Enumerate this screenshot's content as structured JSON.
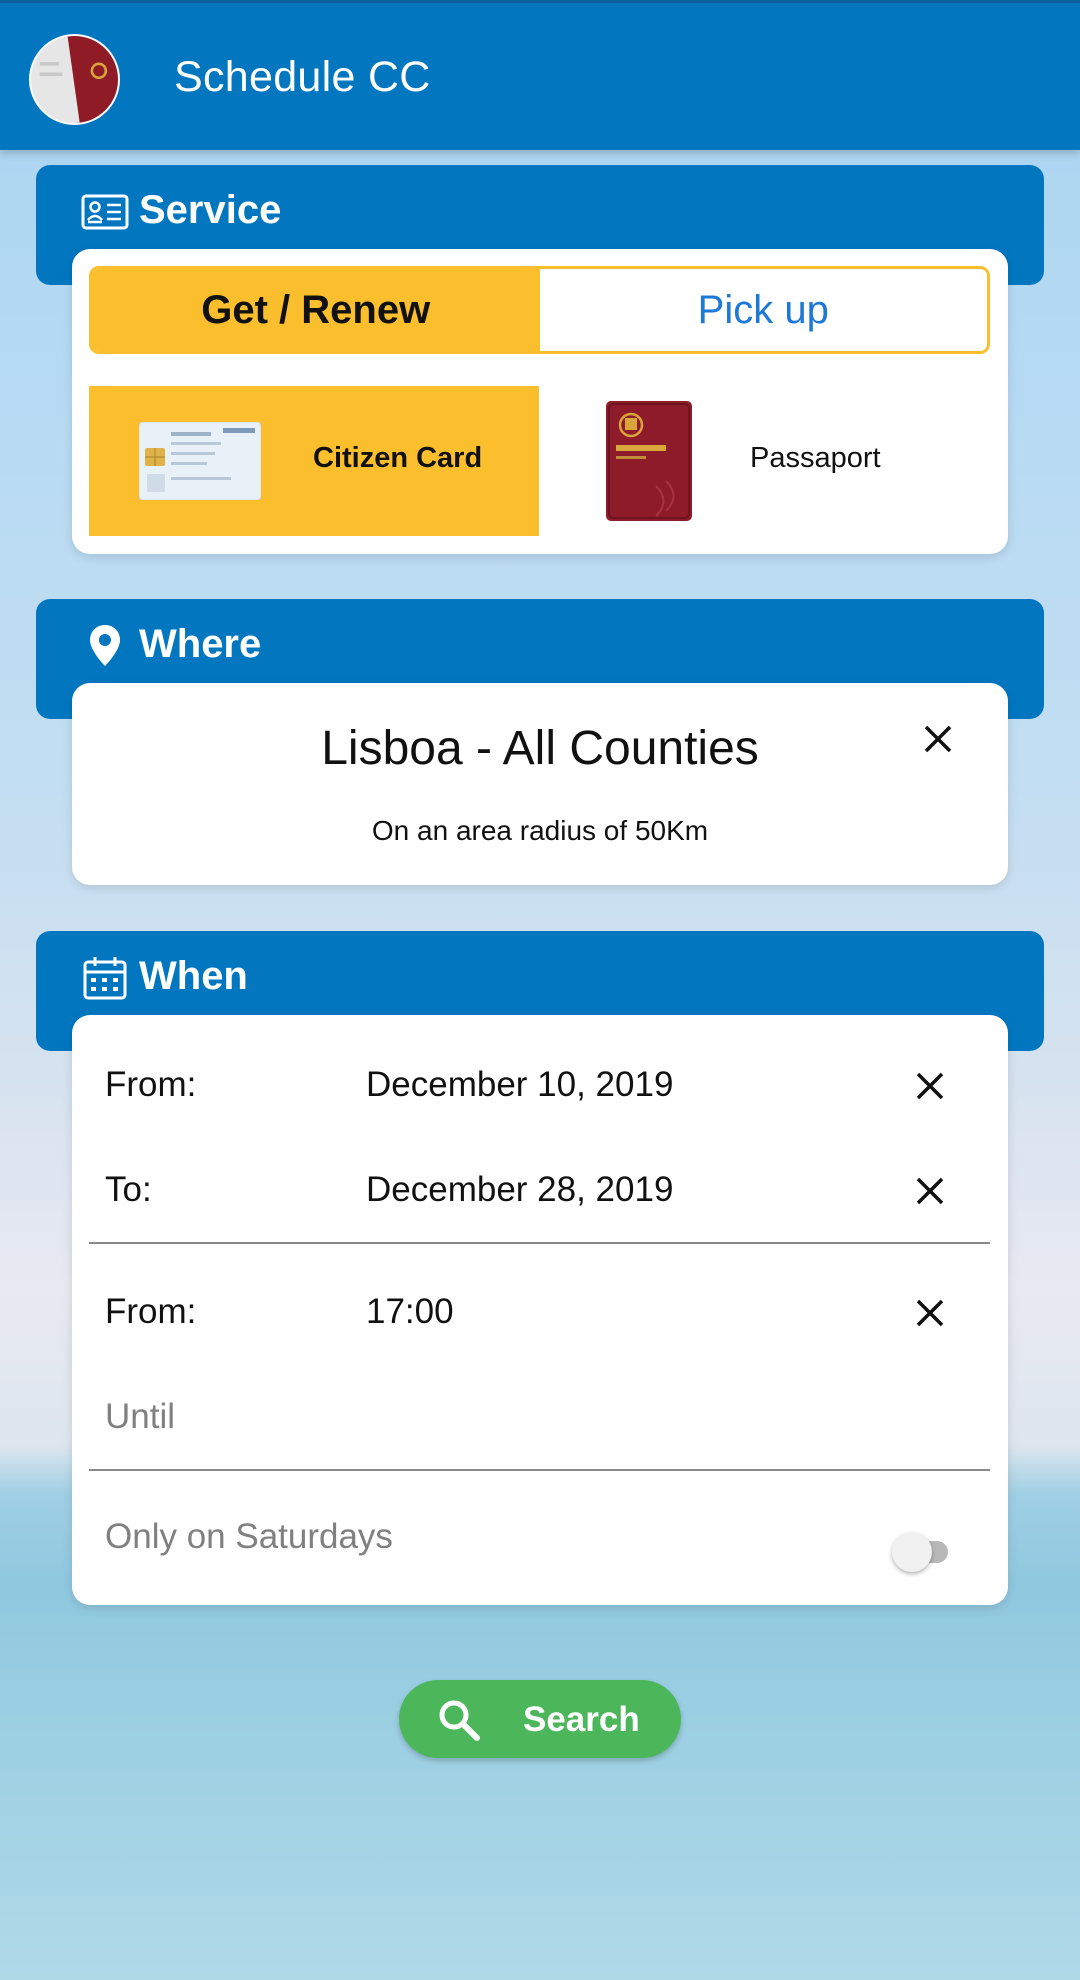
{
  "app": {
    "title": "Schedule CC"
  },
  "service": {
    "title": "Service",
    "tabs": [
      {
        "label": "Get / Renew",
        "selected": true
      },
      {
        "label": "Pick up",
        "selected": false
      }
    ],
    "documents": [
      {
        "label": "Citizen Card",
        "selected": true
      },
      {
        "label": "Passaport",
        "selected": false
      }
    ]
  },
  "where": {
    "title": "Where",
    "location": "Lisboa - All Counties",
    "radius_text": "On an area radius of 50Km"
  },
  "when": {
    "title": "When",
    "date_from_label": "From:",
    "date_from_value": "December 10, 2019",
    "date_to_label": "To:",
    "date_to_value": "December 28, 2019",
    "time_from_label": "From:",
    "time_from_value": "17:00",
    "time_until_label": "Until",
    "saturdays_label": "Only on Saturdays",
    "saturdays_enabled": false
  },
  "actions": {
    "search_label": "Search"
  },
  "colors": {
    "primary": "#0277c0",
    "accent": "#fbbf2d",
    "link": "#1d78d6",
    "search": "#4cb65a"
  }
}
